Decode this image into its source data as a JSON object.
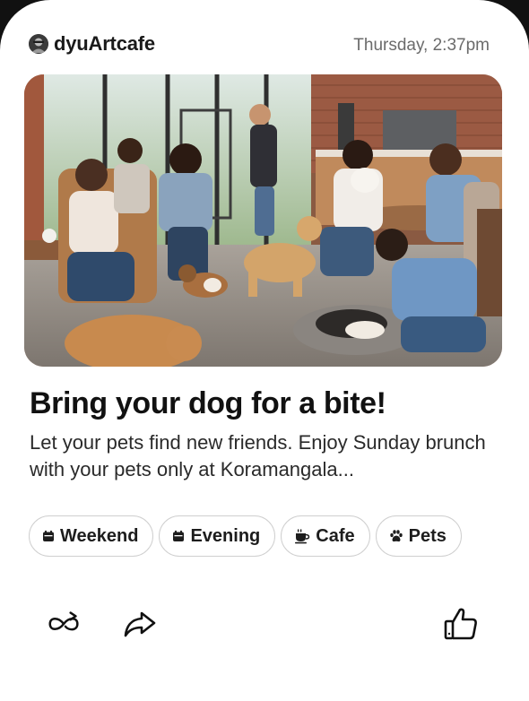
{
  "header": {
    "brand_name": "dyuArtcafe",
    "timestamp": "Thursday, 2:37pm"
  },
  "post": {
    "image_description_icon": "photo",
    "title": "Bring your dog for a bite!",
    "description": "Let your pets find new friends. Enjoy Sunday brunch with your pets only at Koramangala..."
  },
  "tags": [
    {
      "label": "Weekend",
      "icon": "calendar-icon"
    },
    {
      "label": "Evening",
      "icon": "calendar-icon"
    },
    {
      "label": "Cafe",
      "icon": "coffee-cup-icon"
    },
    {
      "label": "Pets",
      "icon": "paw-icon"
    }
  ],
  "actions": {
    "repost_icon": "repost-icon",
    "share_icon": "share-arrow-icon",
    "like_icon": "thumbs-up-icon"
  },
  "colors": {
    "background": "#ffffff",
    "text_primary": "#111111",
    "text_secondary": "#6b6b6b",
    "chip_border": "#cfcfcf"
  }
}
